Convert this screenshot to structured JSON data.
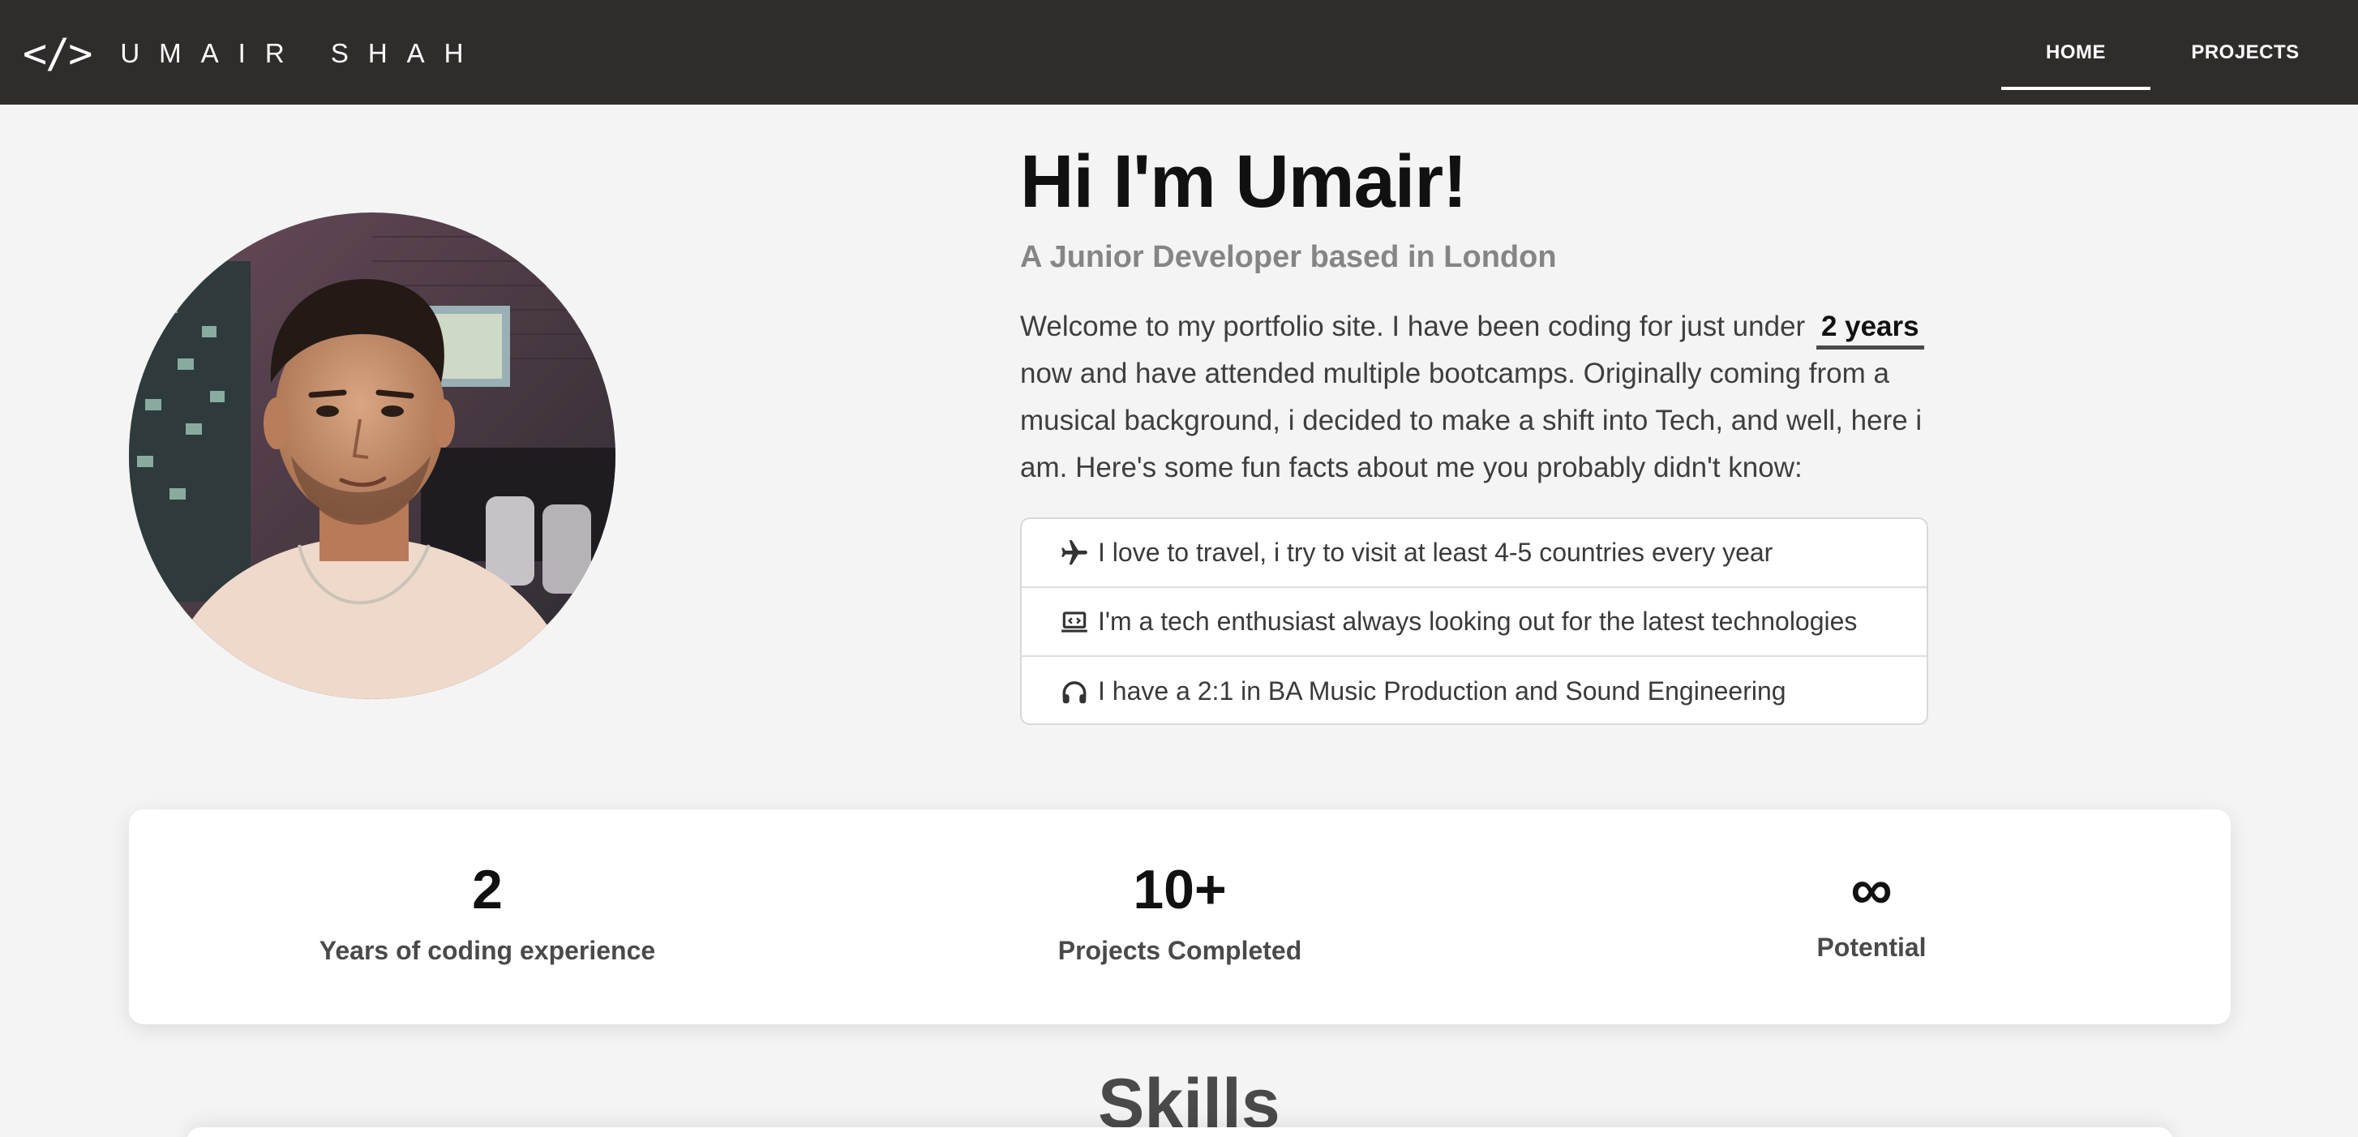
{
  "navbar": {
    "logo": "</>",
    "brand": "UMAIR SHAH",
    "links": [
      {
        "label": "HOME",
        "active": true
      },
      {
        "label": "PROJECTS",
        "active": false
      }
    ]
  },
  "hero": {
    "title": "Hi I'm Umair!",
    "subtitle": "A Junior Developer based in London",
    "intro_before": "Welcome to my portfolio site. I have been coding for just under",
    "intro_highlight": "2 years",
    "intro_after": "now and have attended multiple bootcamps. Originally coming from a musical background, i decided to make a shift into Tech, and well, here i am. Here's some fun facts about me you probably didn't know:",
    "facts": [
      {
        "icon": "plane-icon",
        "text": "I love to travel, i try to visit at least 4-5 countries every year"
      },
      {
        "icon": "laptop-code-icon",
        "text": "I'm a tech enthusiast always looking out for the latest technologies"
      },
      {
        "icon": "headphones-icon",
        "text": "I have a 2:1 in BA Music Production and Sound Engineering"
      }
    ]
  },
  "stats": [
    {
      "value": "2",
      "label": "Years of coding experience"
    },
    {
      "value": "10+",
      "label": "Projects Completed"
    },
    {
      "value": "∞",
      "label": "Potential"
    }
  ],
  "skills": {
    "title": "Skills"
  },
  "colors": {
    "navbar_bg": "#302c2c",
    "page_bg": "#f4f4f4",
    "card_bg": "#ffffff",
    "subtitle": "#858585"
  }
}
